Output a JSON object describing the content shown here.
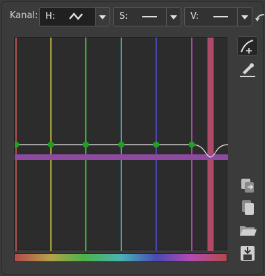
{
  "toolbar": {
    "channel_label": "Kanal:",
    "h": {
      "label": "H:",
      "curve": "wave"
    },
    "s": {
      "label": "S:",
      "curve": "flat"
    },
    "v": {
      "label": "V:",
      "curve": "flat"
    }
  },
  "colors": {
    "accent_curve": "#8e4a9e",
    "node": "#1fa01f",
    "grid_lines": [
      "#b05050",
      "#a8a040",
      "#40a840",
      "#40a8a8",
      "#4848b0",
      "#a848a8",
      "#b04848"
    ]
  },
  "icons": {
    "reset": "reset-curve-icon",
    "edit_curve": "edit-curve-icon",
    "eyedropper": "eyedropper-icon",
    "copy": "copy-curve-icon",
    "paste": "paste-curve-icon",
    "open": "open-folder-icon",
    "save": "save-icon"
  }
}
